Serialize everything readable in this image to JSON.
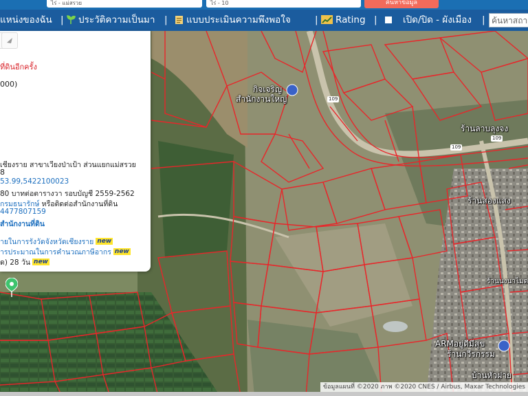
{
  "topstrip": {
    "field1": "ไร่ - แม่สรวย",
    "field2": "ไร่ - 10",
    "search_label": "ค้นหาข้อมูล"
  },
  "nav": {
    "item1": "แหน่งของฉัน",
    "item2": "ประวัติความเป็นมา",
    "item3": "แบบประเมินความพึงพอใจ",
    "item4": "Rating",
    "item5": "เปิด/ปิด - ผังเมือง",
    "search_placeholder": "ค้นหาสถาน"
  },
  "panel": {
    "line1": "ที่ดินอีกครั้ง",
    "line2": "000)",
    "line3": "8",
    "line4": "เชียงราย สาขาเวียงป่าเป้า ส่วนแยกแม่สรวย",
    "line5": "53.99,5422100023",
    "line6": "80 บาทต่อตารางวา รอบบัญชี 2559-2562",
    "line7a": "กรมธนารักษ์",
    "line7b": " หรือติดต่อสำนักงานที่ดิน",
    "line8": "4477807159",
    "line9": "สำนักงานที่ดิน",
    "line10": "ายในการรังวัดจังหวัดเชียงราย",
    "line11": "ารประมาณในการคำนวณภาษีอากร",
    "line12": "ด) 28 วัน",
    "new_badge": "new"
  },
  "map": {
    "poi1": "กิจเจริญ",
    "poi2": "สำนักงานใหญ่",
    "poi3": "ร้านลาบลุงจง",
    "poi4": "ร้านสองแสง",
    "poi5": "ARMอยู่ดีมีสุข",
    "poi6": "ร้านกวีรกรรม",
    "poi7": "บ้านหัวฝาย",
    "poi8": "ร้านนงนาไมด",
    "road1": "109",
    "road2": "109",
    "road3": "109",
    "attribution": "ข้อมูลแผนที่ ©2020 ภาพ ©2020 CNES / Airbus, Maxar Technologies",
    "parcel_color": "#e8262a"
  }
}
